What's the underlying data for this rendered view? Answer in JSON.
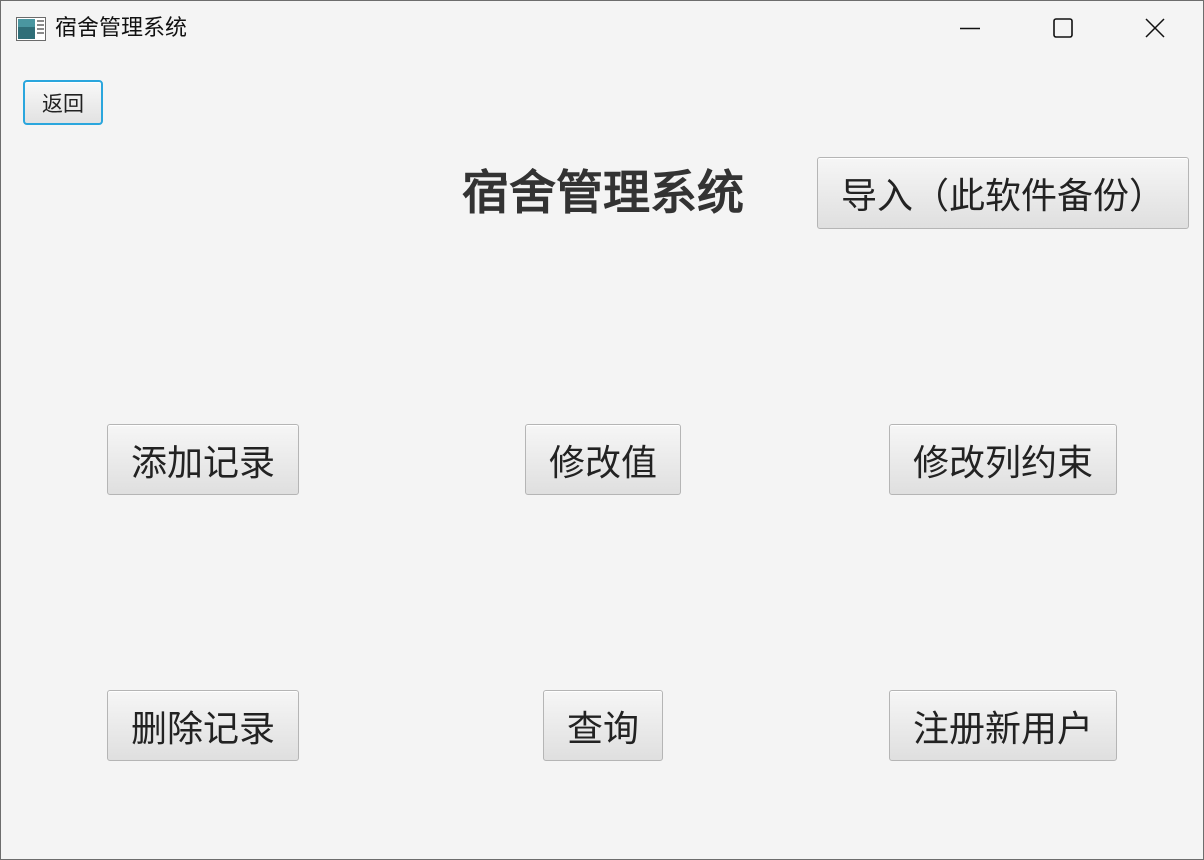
{
  "window": {
    "title": "宿舍管理系统"
  },
  "toolbar": {
    "back_label": "返回"
  },
  "main": {
    "title": "宿舍管理系统",
    "import_label": "导入（此软件备份）",
    "add_record_label": "添加记录",
    "modify_value_label": "修改值",
    "modify_constraint_label": "修改列约束",
    "delete_record_label": "删除记录",
    "query_label": "查询",
    "register_user_label": "注册新用户"
  },
  "icons": {
    "app": "app-window-icon",
    "minimize": "minimize-icon",
    "maximize": "maximize-icon",
    "close": "close-icon"
  },
  "colors": {
    "background": "#f4f4f4",
    "focus_border": "#2aa6dd",
    "title_text": "#333333"
  }
}
